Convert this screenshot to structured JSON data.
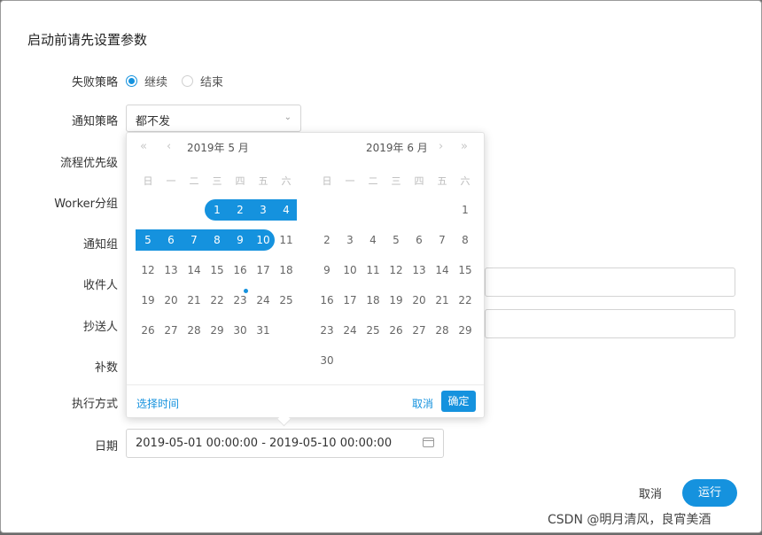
{
  "dialog": {
    "title": "启动前请先设置参数"
  },
  "form": {
    "failure_label": "失败策略",
    "failure_options": [
      "继续",
      "结束"
    ],
    "notify_label": "通知策略",
    "notify_value": "都不发",
    "priority_label": "流程优先级",
    "worker_label": "Worker分组",
    "group_label": "通知组",
    "recipient_label": "收件人",
    "cc_label": "抄送人",
    "complement_label": "补数",
    "exec_label": "执行方式",
    "date_label": "日期",
    "date_range": "2019-05-01 00:00:00 - 2019-05-10 00:00:00"
  },
  "picker": {
    "left_title": "2019年 5 月",
    "right_title": "2019年 6 月",
    "weekdays": [
      "日",
      "一",
      "二",
      "三",
      "四",
      "五",
      "六"
    ],
    "left_days": [
      [
        "",
        "",
        "",
        "1",
        "2",
        "3",
        "4"
      ],
      [
        "5",
        "6",
        "7",
        "8",
        "9",
        "10",
        "11"
      ],
      [
        "12",
        "13",
        "14",
        "15",
        "16",
        "17",
        "18"
      ],
      [
        "19",
        "20",
        "21",
        "22",
        "23",
        "24",
        "25"
      ],
      [
        "26",
        "27",
        "28",
        "29",
        "30",
        "31",
        ""
      ]
    ],
    "right_days": [
      [
        "",
        "",
        "",
        "",
        "",
        "",
        "1"
      ],
      [
        "2",
        "3",
        "4",
        "5",
        "6",
        "7",
        "8"
      ],
      [
        "9",
        "10",
        "11",
        "12",
        "13",
        "14",
        "15"
      ],
      [
        "16",
        "17",
        "18",
        "19",
        "20",
        "21",
        "22"
      ],
      [
        "23",
        "24",
        "25",
        "26",
        "27",
        "28",
        "29"
      ],
      [
        "30",
        "",
        "",
        "",
        "",
        "",
        ""
      ]
    ],
    "select_time": "选择时间",
    "cancel": "取消",
    "confirm": "确定"
  },
  "footer": {
    "cancel": "取消",
    "run": "运行"
  },
  "watermark": "CSDN @明月清风，良宵美酒",
  "colors": {
    "accent": "#1592de"
  }
}
